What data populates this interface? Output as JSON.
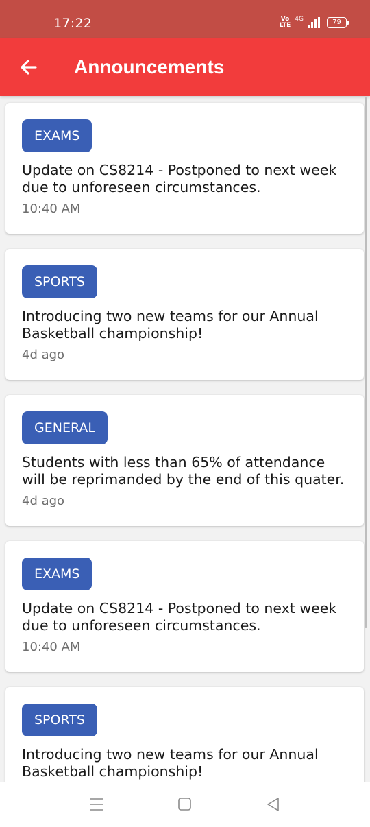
{
  "status_bar": {
    "time": "17:22",
    "volte_top": "Vo",
    "volte_bottom": "LTE",
    "network": "4G",
    "battery": "79"
  },
  "app_bar": {
    "title": "Announcements"
  },
  "announcements": [
    {
      "tag": "EXAMS",
      "message": "Update on CS8214 - Postponed to next week due to unforeseen circumstances.",
      "time": "10:40 AM"
    },
    {
      "tag": "SPORTS",
      "message": "Introducing two new teams for our Annual Basketball championship!",
      "time": "4d ago"
    },
    {
      "tag": "GENERAL",
      "message": "Students with less than 65% of attendance will be reprimanded by the end of this quater.",
      "time": "4d ago"
    },
    {
      "tag": "EXAMS",
      "message": "Update on CS8214 - Postponed to next week due to unforeseen circumstances.",
      "time": "10:40 AM"
    },
    {
      "tag": "SPORTS",
      "message": "Introducing two new teams for our Annual Basketball championship!",
      "time": ""
    }
  ],
  "icons": {
    "back": "arrow-left-icon",
    "menu": "recent-apps-icon",
    "home": "home-square-icon",
    "back_nav": "back-triangle-icon"
  },
  "colors": {
    "status_bar": "#c24d45",
    "app_bar": "#f23c3c",
    "tag": "#3a5fb5"
  }
}
